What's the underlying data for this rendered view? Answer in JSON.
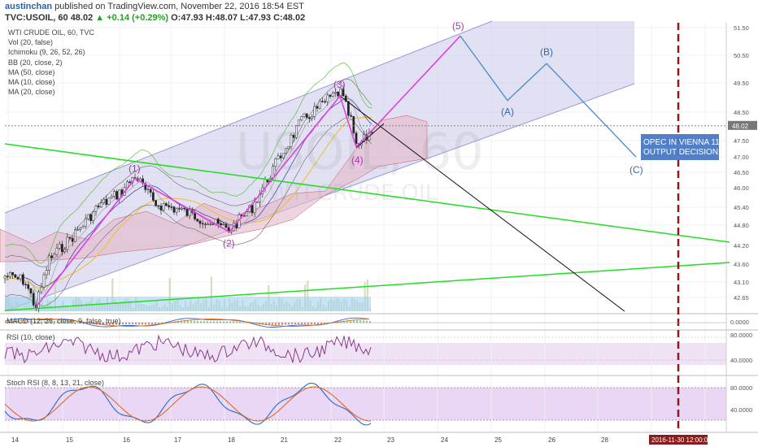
{
  "header": {
    "author": "austinchan",
    "published": "published on TradingView.com, November 22, 2016 18:54 EST",
    "symbol": "TVC:USOIL, 60",
    "last": "48.02",
    "change": "▲ +0.14 (+0.29%)",
    "ohlc": "O:47.93 H:48.07 L:47.93 C:48.02"
  },
  "indicators": [
    "WTI CRUDE OIL, 60, TVC",
    "Vol (20, false)",
    "Ichimoku (9, 26, 52, 26)",
    "BB (20, close, 2)",
    "MA (50, close)",
    "MA (10, close)",
    "MA (20, close)"
  ],
  "watermark": {
    "line1": "USOIL, 60",
    "line2": "WTI CRUDE OIL"
  },
  "panes": {
    "macd_label": "MACD (12, 26, close, 9, false, true)",
    "rsi_label": "RSI (10, close)",
    "stoch_label": "Stoch RSI (8, 8, 13, 21, close)"
  },
  "annotation": {
    "line1": "OPEC IN VIENNA 11/",
    "line2": "OUTPUT DECISION"
  },
  "axis_badge": {
    "date": "2016-11-30 12:00:00",
    "price": "48.02"
  },
  "colors": {
    "wave": "#e040e0",
    "corrective": "#4a8ac8",
    "trendline": "#22dd22",
    "channel_fill": "#c8c8ea",
    "marker": "#8b1a1a",
    "annotation_bg": "#4a78c4"
  },
  "chart_data": {
    "type": "line",
    "title": "WTI CRUDE OIL, 60, TVC",
    "x_ticks": [
      "14",
      "15",
      "16",
      "17",
      "18",
      "21",
      "22",
      "23",
      "24",
      "25",
      "26",
      "28",
      "29",
      "30"
    ],
    "y_ticks": [
      51.5,
      50.5,
      49.5,
      48.5,
      47.5,
      47.0,
      46.5,
      46.0,
      45.4,
      44.8,
      44.2,
      43.6,
      43.1,
      42.65
    ],
    "ylim": [
      42.3,
      51.7
    ],
    "current_price": 48.02,
    "wave_labels": [
      "(1)",
      "(2)",
      "(3)",
      "(4)",
      "(5)",
      "(A)",
      "(B)",
      "(C)"
    ],
    "impulse_wave": [
      {
        "label": "",
        "x": "14",
        "y": 42.35
      },
      {
        "label": "(1)",
        "x": "16",
        "y": 46.3
      },
      {
        "label": "(2)",
        "x": "18",
        "y": 44.6
      },
      {
        "label": "(3)",
        "x": "22",
        "y": 49.05
      },
      {
        "label": "(4)",
        "x": "22",
        "y": 47.3
      },
      {
        "label": "(5)",
        "x": "24",
        "y": 51.2
      }
    ],
    "corrective_wave": [
      {
        "label": "(5)",
        "x": "24",
        "y": 51.2
      },
      {
        "label": "(A)",
        "x": "25",
        "y": 48.9
      },
      {
        "label": "(B)",
        "x": "26",
        "y": 50.2
      },
      {
        "label": "(C)",
        "x": "29",
        "y": 47.0
      }
    ],
    "rsi_levels": [
      80,
      40
    ],
    "stoch_levels": [
      80,
      40
    ],
    "macd_level": 0
  }
}
